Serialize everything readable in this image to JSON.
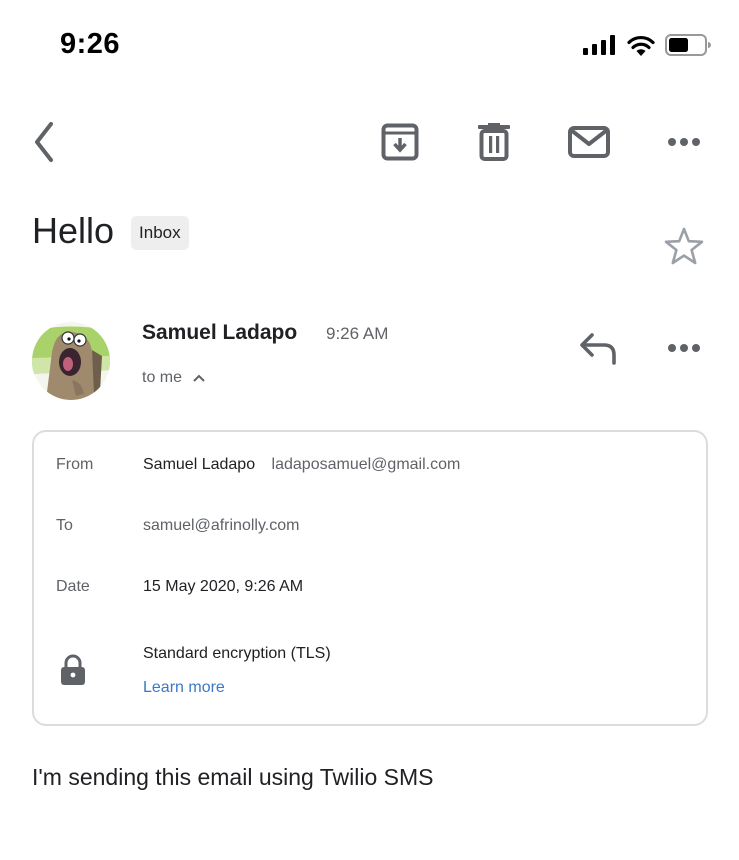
{
  "status_bar": {
    "time": "9:26",
    "icons": [
      "cellular-signal-icon",
      "wifi-icon",
      "battery-icon"
    ]
  },
  "toolbar": {
    "back_icon": "chevron-left-icon",
    "actions": [
      {
        "name": "archive",
        "icon": "archive-icon"
      },
      {
        "name": "delete",
        "icon": "trash-icon"
      },
      {
        "name": "mark-unread",
        "icon": "mail-icon"
      },
      {
        "name": "more",
        "icon": "more-horizontal-icon"
      }
    ]
  },
  "email": {
    "subject": "Hello",
    "label": "Inbox",
    "starred": false,
    "sender_name": "Samuel Ladapo",
    "time": "9:26 AM",
    "recipient_summary": "to me",
    "body": "I'm sending this email using Twilio SMS"
  },
  "details": {
    "from_label": "From",
    "from_name": "Samuel Ladapo",
    "from_email": "ladaposamuel@gmail.com",
    "to_label": "To",
    "to_email": "samuel@afrinolly.com",
    "date_label": "Date",
    "date_value": "15 May 2020, 9:26 AM",
    "encryption": "Standard encryption (TLS)",
    "learn_more": "Learn more"
  },
  "colors": {
    "icon_gray": "#5f6368",
    "link_blue": "#3c78c8",
    "chip_bg": "#eeeeee",
    "border": "#dadce0"
  }
}
